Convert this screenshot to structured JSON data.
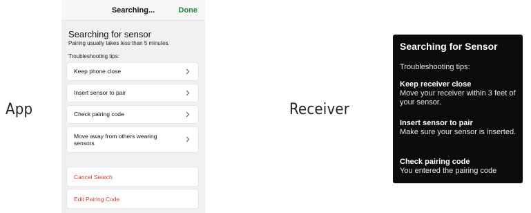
{
  "labels": {
    "app": "App",
    "receiver": "Receiver"
  },
  "app": {
    "title": "Searching...",
    "done": "Done",
    "heading": "Searching for sensor",
    "subtext": "Pairing usually takes less than 5 minutes.",
    "tips_label": "Troubleshooting tips:",
    "tips": [
      "Keep phone close",
      "Insert sensor to pair",
      "Check pairing code",
      "Move away from others wearing sensors"
    ],
    "actions": [
      "Cancel Search",
      "Edit Pairing Code"
    ],
    "colors": {
      "done": "#1a8a3a",
      "action": "#d83a3a"
    }
  },
  "receiver": {
    "title": "Searching for Sensor",
    "tips_label": "Troubleshooting tips:",
    "tips": [
      {
        "heading": "Keep receiver close",
        "body": "Move your receiver within 3 feet of your sensor."
      },
      {
        "heading": "Insert sensor to pair",
        "body": "Make sure your sensor is inserted."
      },
      {
        "heading": "Check pairing code",
        "body": "You entered the pairing code"
      }
    ]
  }
}
